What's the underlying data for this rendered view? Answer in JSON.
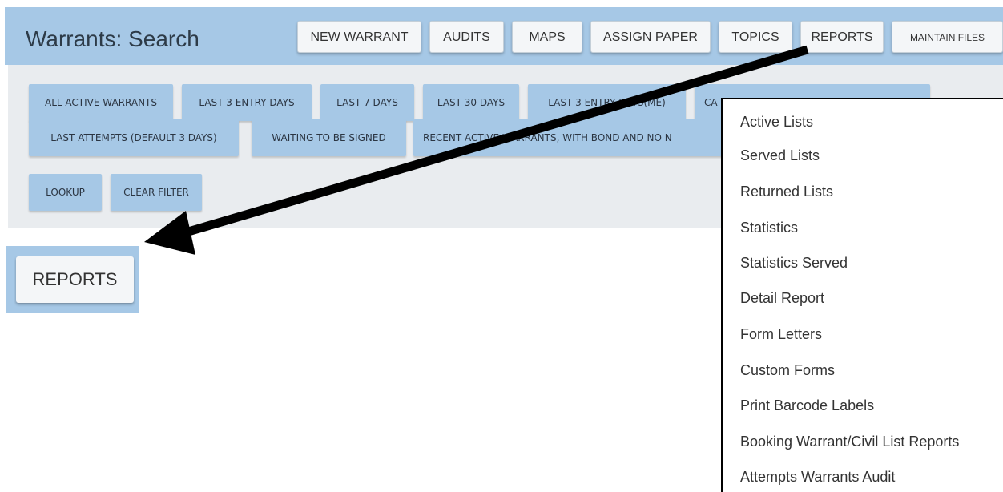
{
  "header": {
    "title": "Warrants: Search",
    "buttons": [
      "NEW WARRANT",
      "AUDITS",
      "MAPS",
      "ASSIGN PAPER",
      "TOPICS",
      "REPORTS",
      "MAINTAIN FILES"
    ]
  },
  "filters": {
    "row1": [
      "ALL ACTIVE WARRANTS",
      "LAST 3 ENTRY DAYS",
      "LAST 7 DAYS",
      "LAST 30 DAYS",
      "LAST 3 ENTRY DAYS(ME)",
      "CA"
    ],
    "row2": [
      "LAST ATTEMPTS (DEFAULT 3 DAYS)",
      "WAITING TO BE SIGNED",
      "RECENT ACTIVE WARRANTS, WITH BOND AND NO N"
    ],
    "row3": [
      "LOOKUP",
      "CLEAR FILTER"
    ]
  },
  "callout": {
    "label": "REPORTS"
  },
  "reports_menu": {
    "items": [
      "Active Lists",
      "Served Lists",
      "Returned Lists",
      "Statistics",
      "Statistics Served",
      "Detail Report",
      "Form Letters",
      "Custom Forms",
      "Print Barcode Labels",
      "Booking Warrant/Civil List Reports",
      "Attempts Warrants Audit"
    ]
  },
  "colors": {
    "bar": "#a6c8e6",
    "panel": "#e9ecef",
    "button": "#f4f6f8"
  }
}
